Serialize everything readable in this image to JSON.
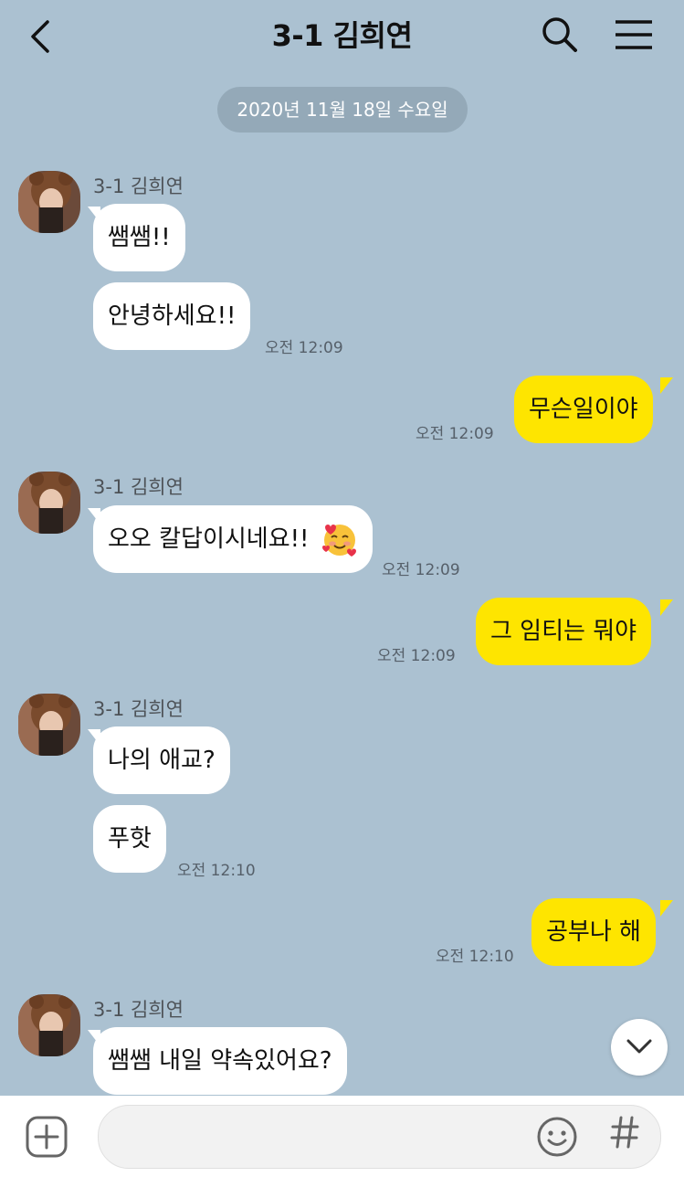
{
  "header": {
    "title": "3-1 김희연",
    "back_icon": "chevron-left-icon",
    "search_icon": "search-icon",
    "menu_icon": "hamburger-menu-icon"
  },
  "date_divider": "2020년 11월 18일 수요일",
  "sender_name": "3-1 김희연",
  "messages": [
    {
      "text": "쌤쌤!!"
    },
    {
      "text": "안녕하세요!!",
      "time": "오전 12:09"
    },
    {
      "text": "무슨일이야",
      "time": "오전 12:09"
    },
    {
      "text": "오오 칼답이시네요!!",
      "time": "오전 12:09",
      "emoji": "smiling-face-with-hearts"
    },
    {
      "text": "그 임티는 뭐야",
      "time": "오전 12:09"
    },
    {
      "text": "나의 애교?"
    },
    {
      "text": "푸핫",
      "time": "오전 12:10"
    },
    {
      "text": "공부나 해",
      "time": "오전 12:10"
    },
    {
      "text": "쌤쌤 내일 약속있어요?"
    }
  ],
  "input": {
    "placeholder": ""
  },
  "colors": {
    "background": "#abc1d1",
    "outgoing_bubble": "#fee500",
    "incoming_bubble": "#ffffff",
    "date_pill": "#94a9b8"
  }
}
